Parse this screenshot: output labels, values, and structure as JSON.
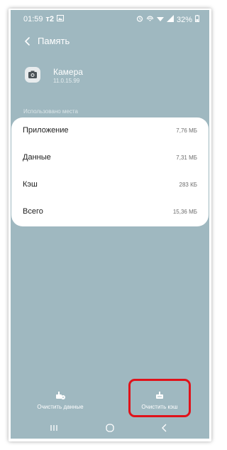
{
  "status_bar": {
    "time": "01:59",
    "carrier": "т2",
    "battery": "32%"
  },
  "app_bar": {
    "title": "Память"
  },
  "app": {
    "name": "Камера",
    "version": "11.0.15.99",
    "icon": "camera-icon"
  },
  "storage": {
    "section_title": "Использовано места",
    "rows": [
      {
        "label": "Приложение",
        "value": "7,76 МБ"
      },
      {
        "label": "Данные",
        "value": "7,31 МБ"
      },
      {
        "label": "Кэш",
        "value": "283 КБ"
      },
      {
        "label": "Всего",
        "value": "15,36 МБ"
      }
    ]
  },
  "actions": {
    "clear_data": "Очистить данные",
    "clear_cache": "Очистить кэш"
  },
  "colors": {
    "background": "#9fb8c0",
    "highlight": "#e0121a"
  }
}
